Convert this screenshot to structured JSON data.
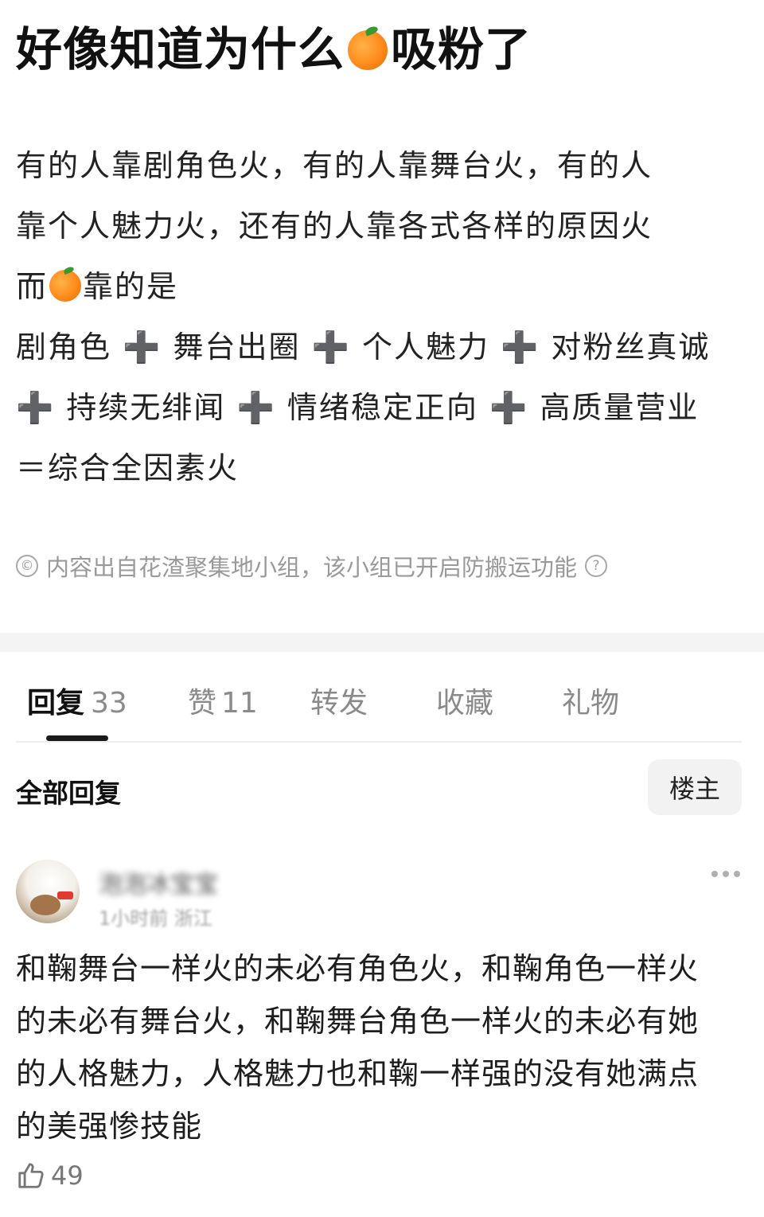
{
  "post": {
    "title_before": "好像知道为什么",
    "title_after": "吸粉了",
    "title_icon": "orange-emoji",
    "body_lines": [
      "有的人靠剧角色火，有的人靠舞台火，有的人",
      "靠个人魅力火，还有的人靠各式各样的原因火"
    ],
    "line3_before": "而",
    "line3_after": "靠的是",
    "line4": "剧角色 ➕ 舞台出圈 ➕ 个人魅力 ➕ 对粉丝真诚",
    "line5": "➕ 持续无绯闻 ➕ 情绪稳定正向 ➕ 高质量营业",
    "line6": "＝综合全因素火",
    "notice": "内容出自花渣聚集地小组，该小组已开启防搬运功能",
    "notice_icon": "©"
  },
  "tabs": [
    {
      "label": "回复",
      "count": "33",
      "active": true
    },
    {
      "label": "赞",
      "count": "11",
      "active": false
    },
    {
      "label": "转发",
      "count": "",
      "active": false
    },
    {
      "label": "收藏",
      "count": "",
      "active": false
    },
    {
      "label": "礼物",
      "count": "",
      "active": false
    }
  ],
  "filter": {
    "title": "全部回复",
    "op_button": "楼主"
  },
  "comment": {
    "username": "泡泡冰宝宝",
    "meta": "1小时前 浙江",
    "lines": [
      "和鞠舞台一样火的未必有角色火，和鞠角色一样火",
      "的未必有舞台火，和鞠舞台角色一样火的未必有她",
      "的人格魅力，人格魅力也和鞠一样强的没有她满点",
      "的美强惨技能"
    ],
    "likes": "49"
  },
  "colors": {
    "divider_band": "#f4f4f4",
    "muted_text": "#9a9a9a",
    "tab_indicator": "#1a1a1a"
  }
}
